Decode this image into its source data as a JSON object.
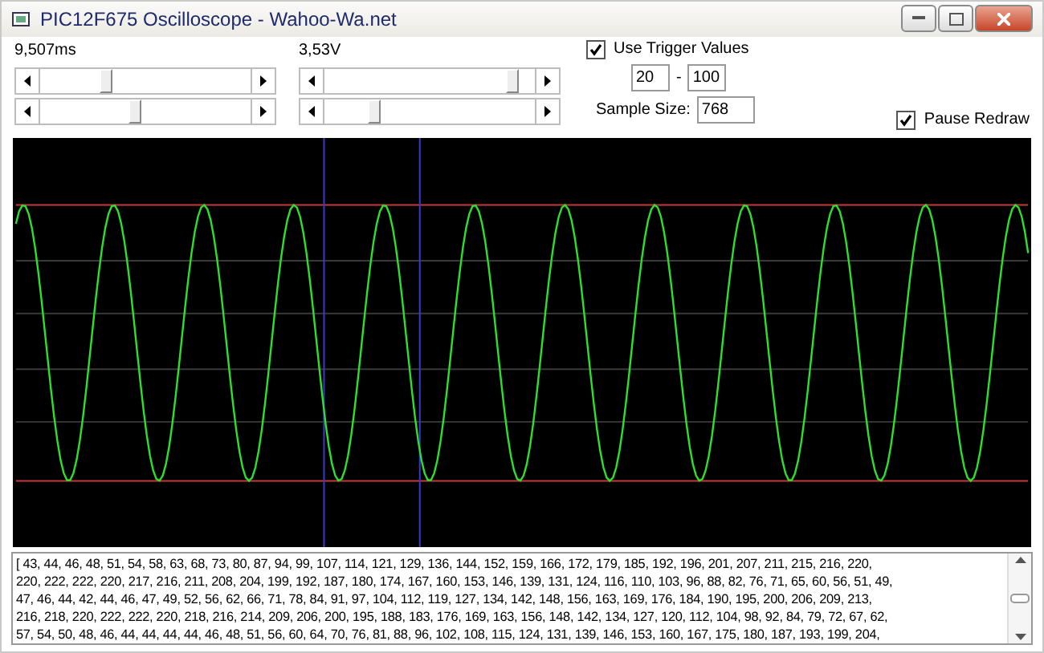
{
  "window": {
    "title": "PIC12F675 Oscilloscope - Wahoo-Wa.net"
  },
  "time_scale": {
    "reading": "9,507ms",
    "sliders": [
      {
        "level": 0.3
      },
      {
        "level": 0.45
      }
    ]
  },
  "voltage_scale": {
    "reading": "3,53V",
    "sliders": [
      {
        "level": 0.92
      },
      {
        "level": 0.22
      }
    ]
  },
  "trigger": {
    "label": "Use Trigger Values",
    "checked": true,
    "low": "20",
    "separator": "-",
    "high": "100"
  },
  "sample_size": {
    "label": "Sample Size:",
    "value": "768"
  },
  "pause_redraw": {
    "label": "Pause Redraw",
    "checked": true
  },
  "samples": {
    "lines": [
      "[ 43, 44, 46, 48, 51, 54, 58, 63, 68, 73, 80, 87, 94, 99, 107, 114, 121, 129, 136, 144, 152, 159, 166, 172, 179, 185, 192, 196, 201, 207, 211, 215, 216, 220,",
      "220, 222, 222, 220, 217, 216, 211, 208, 204, 199, 192, 187, 180, 174, 167, 160, 153, 146, 139, 131, 124, 116, 110, 103, 96, 88, 82, 76, 71, 65, 60, 56, 51, 49,",
      "47, 46, 44, 42, 44, 46, 47, 49, 52, 56, 62, 66, 71, 78, 84, 91, 97, 104, 112, 119, 127, 134, 142, 148, 156, 163, 169, 176, 184, 190, 195, 200, 206, 209, 213,",
      "216, 218, 220, 222, 222, 220, 218, 216, 214, 209, 206, 200, 195, 188, 183, 176, 169, 163, 156, 148, 142, 134, 127, 120, 112, 104, 98, 92, 84, 79, 72, 67, 62,",
      "57, 54, 50, 48, 46, 44, 44, 44, 44, 46, 48, 51, 56, 60, 64, 70, 76, 81, 88, 96, 102, 108, 115, 124, 131, 139, 146, 153, 160, 167, 175, 180, 187, 193, 199, 204,"
    ]
  }
}
